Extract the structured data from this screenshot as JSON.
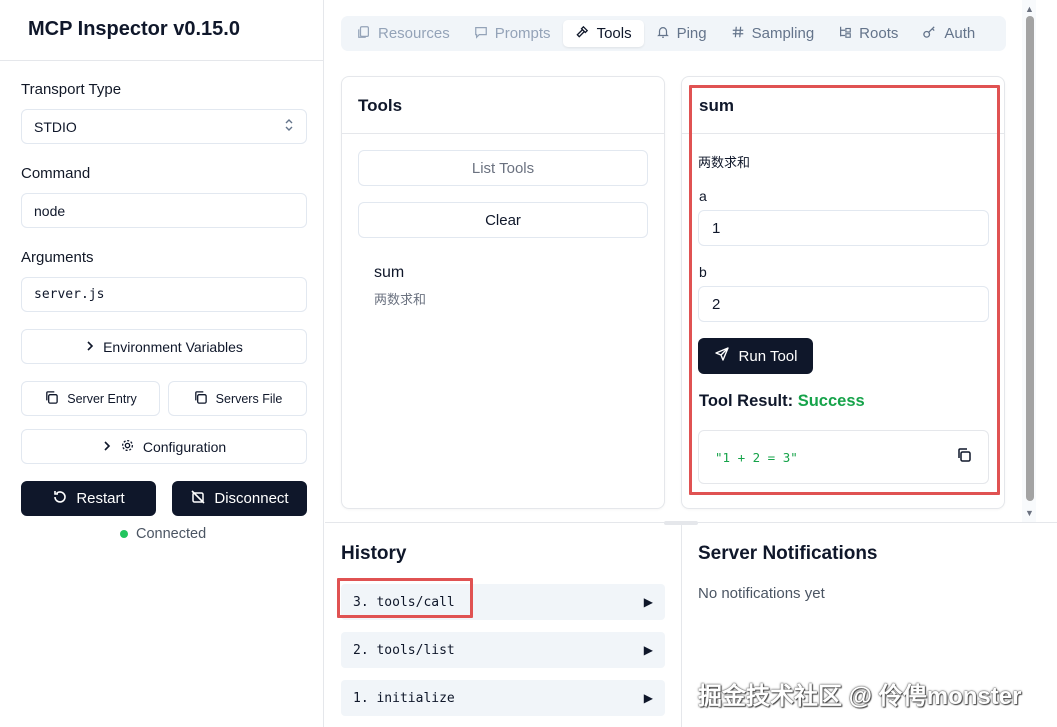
{
  "app": {
    "title": "MCP Inspector v0.15.0"
  },
  "sidebar": {
    "transport_label": "Transport Type",
    "transport_value": "STDIO",
    "command_label": "Command",
    "command_value": "node",
    "arguments_label": "Arguments",
    "arguments_value": "server.js",
    "env_vars_label": "Environment Variables",
    "server_entry_label": "Server Entry",
    "servers_file_label": "Servers File",
    "configuration_label": "Configuration",
    "restart_label": "Restart",
    "disconnect_label": "Disconnect",
    "status_text": "Connected",
    "status_color": "#22c55e"
  },
  "tabs": [
    {
      "label": "Resources",
      "icon": "resources-icon"
    },
    {
      "label": "Prompts",
      "icon": "prompts-icon"
    },
    {
      "label": "Tools",
      "icon": "hammer-icon",
      "active": true
    },
    {
      "label": "Ping",
      "icon": "bell-icon"
    },
    {
      "label": "Sampling",
      "icon": "hash-icon"
    },
    {
      "label": "Roots",
      "icon": "roots-icon"
    },
    {
      "label": "Auth",
      "icon": "key-icon"
    }
  ],
  "tools_panel": {
    "title": "Tools",
    "list_tools_label": "List Tools",
    "clear_label": "Clear",
    "items": [
      {
        "name": "sum",
        "description": "两数求和"
      }
    ]
  },
  "tool_detail": {
    "title": "sum",
    "description": "两数求和",
    "param_a_label": "a",
    "param_a_value": "1",
    "param_b_label": "b",
    "param_b_value": "2",
    "run_label": "Run Tool",
    "result_prefix": "Tool Result:",
    "result_status": "Success",
    "result_output": "\"1 + 2 = 3\""
  },
  "history": {
    "title": "History",
    "items": [
      {
        "label": "3. tools/call"
      },
      {
        "label": "2. tools/list"
      },
      {
        "label": "1. initialize"
      }
    ]
  },
  "notifications": {
    "title": "Server Notifications",
    "empty_text": "No notifications yet"
  },
  "watermark": "掘金技术社区 @ 伶俜monster",
  "colors": {
    "accent_dark": "#0f172a",
    "success": "#16a34a",
    "highlight": "#e05252"
  }
}
